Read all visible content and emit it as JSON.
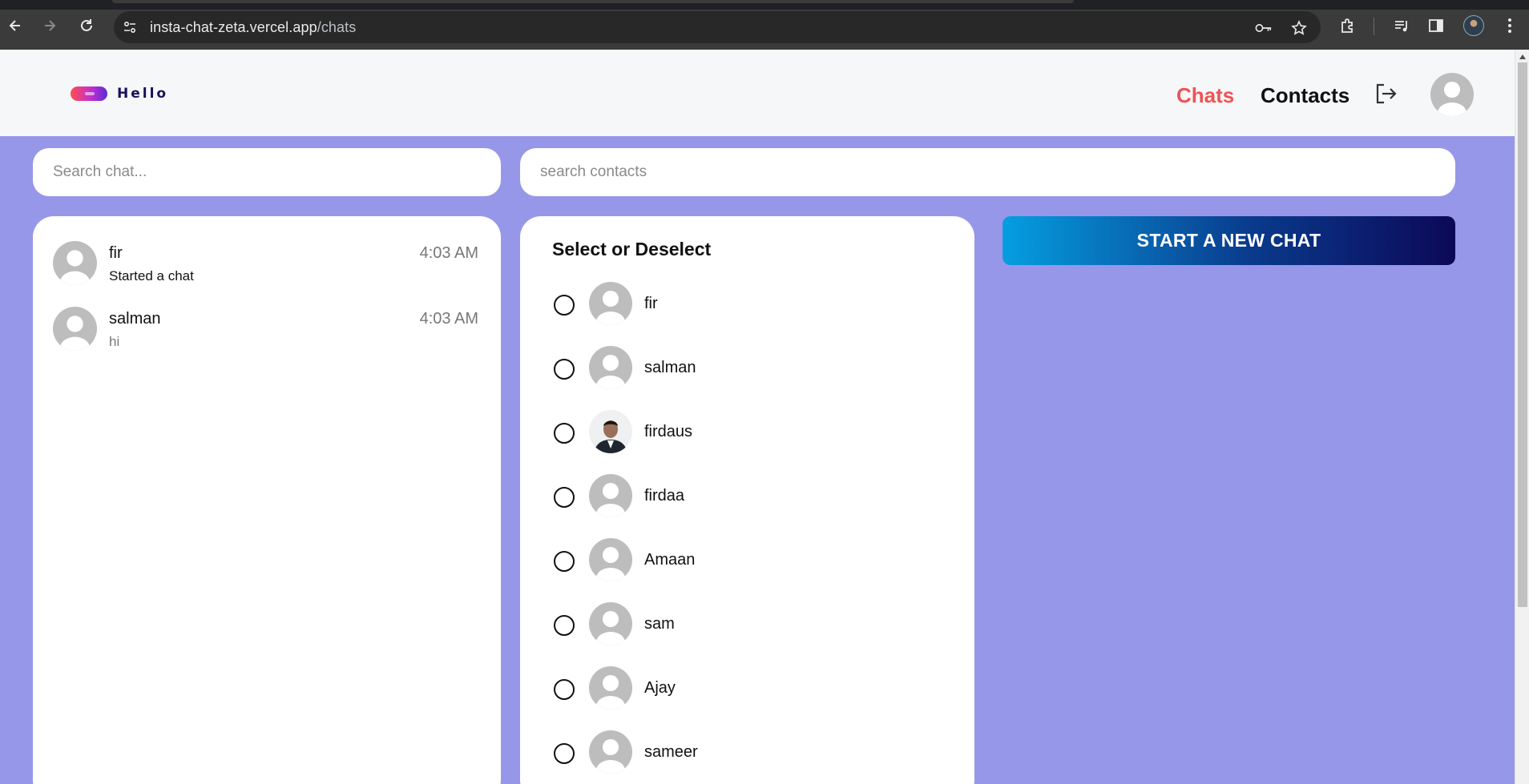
{
  "browser": {
    "url_host": "insta-chat-zeta.vercel.app",
    "url_path": "/chats"
  },
  "header": {
    "logo_text": "Hello",
    "nav": {
      "chats": "Chats",
      "contacts": "Contacts"
    },
    "active_color": "#f05353"
  },
  "search": {
    "chat_placeholder": "Search chat...",
    "contacts_placeholder": "search contacts"
  },
  "chats": [
    {
      "name": "fir",
      "time": "4:03 AM",
      "last_message": "Started a chat"
    },
    {
      "name": "salman",
      "time": "4:03 AM",
      "last_message": "hi"
    }
  ],
  "contacts": {
    "title": "Select or Deselect",
    "items": [
      {
        "name": "fir",
        "photo": false
      },
      {
        "name": "salman",
        "photo": false
      },
      {
        "name": "firdaus",
        "photo": true
      },
      {
        "name": "firdaa",
        "photo": false
      },
      {
        "name": "Amaan",
        "photo": false
      },
      {
        "name": "sam",
        "photo": false
      },
      {
        "name": "Ajay",
        "photo": false
      },
      {
        "name": "sameer",
        "photo": false
      }
    ]
  },
  "actions": {
    "start_chat_label": "START A NEW CHAT"
  },
  "colors": {
    "background": "#9797e9",
    "button_start": "#059ee0",
    "button_end": "#0c0858"
  }
}
